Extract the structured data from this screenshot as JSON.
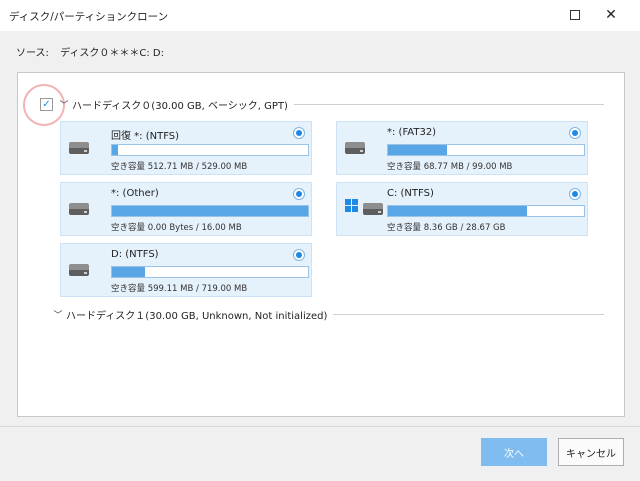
{
  "window": {
    "title": "ディスク/パーティションクローン",
    "maximize_icon": "maximize-icon",
    "close_icon": "close-icon",
    "close_glyph": "✕"
  },
  "source": {
    "label": "ソース:",
    "value": "ディスク０＊＊＊C: D:"
  },
  "disks": [
    {
      "label": "ハードディスク０(30.00 GB, ベーシック, GPT)",
      "checked": true,
      "check_glyph": "✓",
      "expanded": true,
      "chevron_glyph": "﹀",
      "partitions": [
        {
          "name": "回復 *: (NTFS)",
          "capacity": "空き容量 512.71 MB / 529.00 MB",
          "used_fraction": 0.03,
          "icon": "drive-icon",
          "selected": true
        },
        {
          "name": "*: (FAT32)",
          "capacity": "空き容量 68.77 MB / 99.00 MB",
          "used_fraction": 0.3,
          "icon": "drive-icon",
          "selected": true
        },
        {
          "name": "*: (Other)",
          "capacity": "空き容量 0.00 Bytes / 16.00 MB",
          "used_fraction": 1.0,
          "icon": "drive-icon",
          "selected": true
        },
        {
          "name": "C: (NTFS)",
          "capacity": "空き容量 8.36 GB / 28.67 GB",
          "used_fraction": 0.71,
          "icon": "windows-drive-icon",
          "selected": true
        },
        {
          "name": "D: (NTFS)",
          "capacity": "空き容量 599.11 MB / 719.00 MB",
          "used_fraction": 0.17,
          "icon": "drive-icon",
          "selected": true
        }
      ]
    },
    {
      "label": "ハードディスク１(30.00 GB, Unknown, Not initialized)",
      "checked": false,
      "expanded": false,
      "chevron_glyph": "﹀",
      "partitions": []
    }
  ],
  "buttons": {
    "next": "次へ",
    "cancel": "キャンセル"
  },
  "colors": {
    "accent": "#1e88e5",
    "bar_fill": "#58a6e6",
    "card_bg": "#e5f1fb",
    "next_button": "#7fbdf0",
    "highlight_circle": "#f2b3b3"
  }
}
